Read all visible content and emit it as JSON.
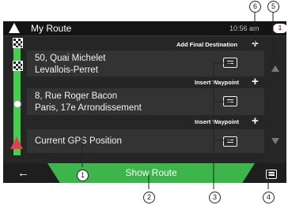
{
  "header": {
    "title": "My Route",
    "time": "10:56",
    "time_suffix": "am",
    "notification_count": "1"
  },
  "route": {
    "add_final_destination_label": "Add Final Destination",
    "waypoints": [
      {
        "line1": "50, Quai Michelet",
        "line2": "Levallois-Perret"
      },
      {
        "line1": "8, Rue Roger Bacon",
        "line2": "Paris, 17e Arrondissement"
      }
    ],
    "insert_waypoint_label": "Insert Waypoint",
    "current_position_label": "Current GPS Position"
  },
  "footer": {
    "show_route_label": "Show Route",
    "back_icon": "←"
  },
  "callouts": {
    "c1": "1",
    "c2": "2",
    "c3": "3",
    "c4": "4",
    "c5": "5",
    "c6": "6"
  },
  "colors": {
    "route_green": "#44d04d",
    "button_green": "#3cb54a",
    "position_red": "#e04050"
  }
}
